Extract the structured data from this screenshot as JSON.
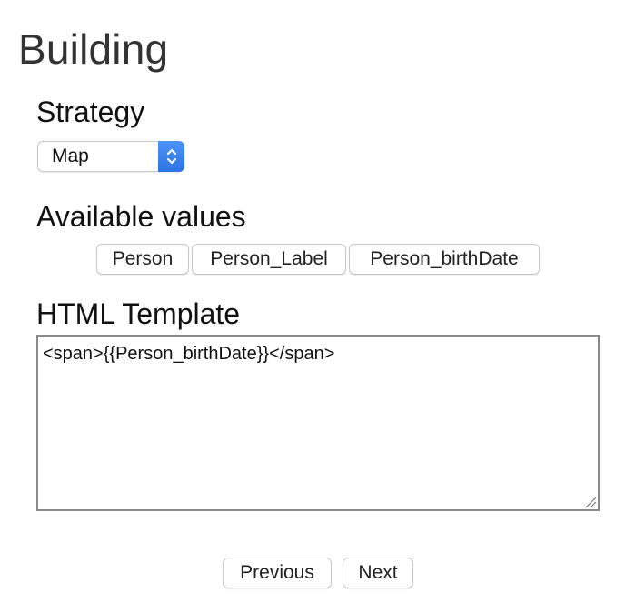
{
  "page": {
    "title": "Building"
  },
  "strategy": {
    "heading": "Strategy",
    "selected": "Map",
    "arrows_icon": "select-updown-chevrons"
  },
  "available_values": {
    "heading": "Available values",
    "buttons": [
      "Person",
      "Person_Label",
      "Person_birthDate"
    ]
  },
  "html_template": {
    "heading": "HTML Template",
    "value": "<span>{{Person_birthDate}}</span>"
  },
  "navigation": {
    "previous_label": "Previous",
    "next_label": "Next"
  },
  "colors": {
    "select_accent": "#3b82f0",
    "border": "#c8c8c8",
    "textarea_border": "#8a8a8a"
  }
}
